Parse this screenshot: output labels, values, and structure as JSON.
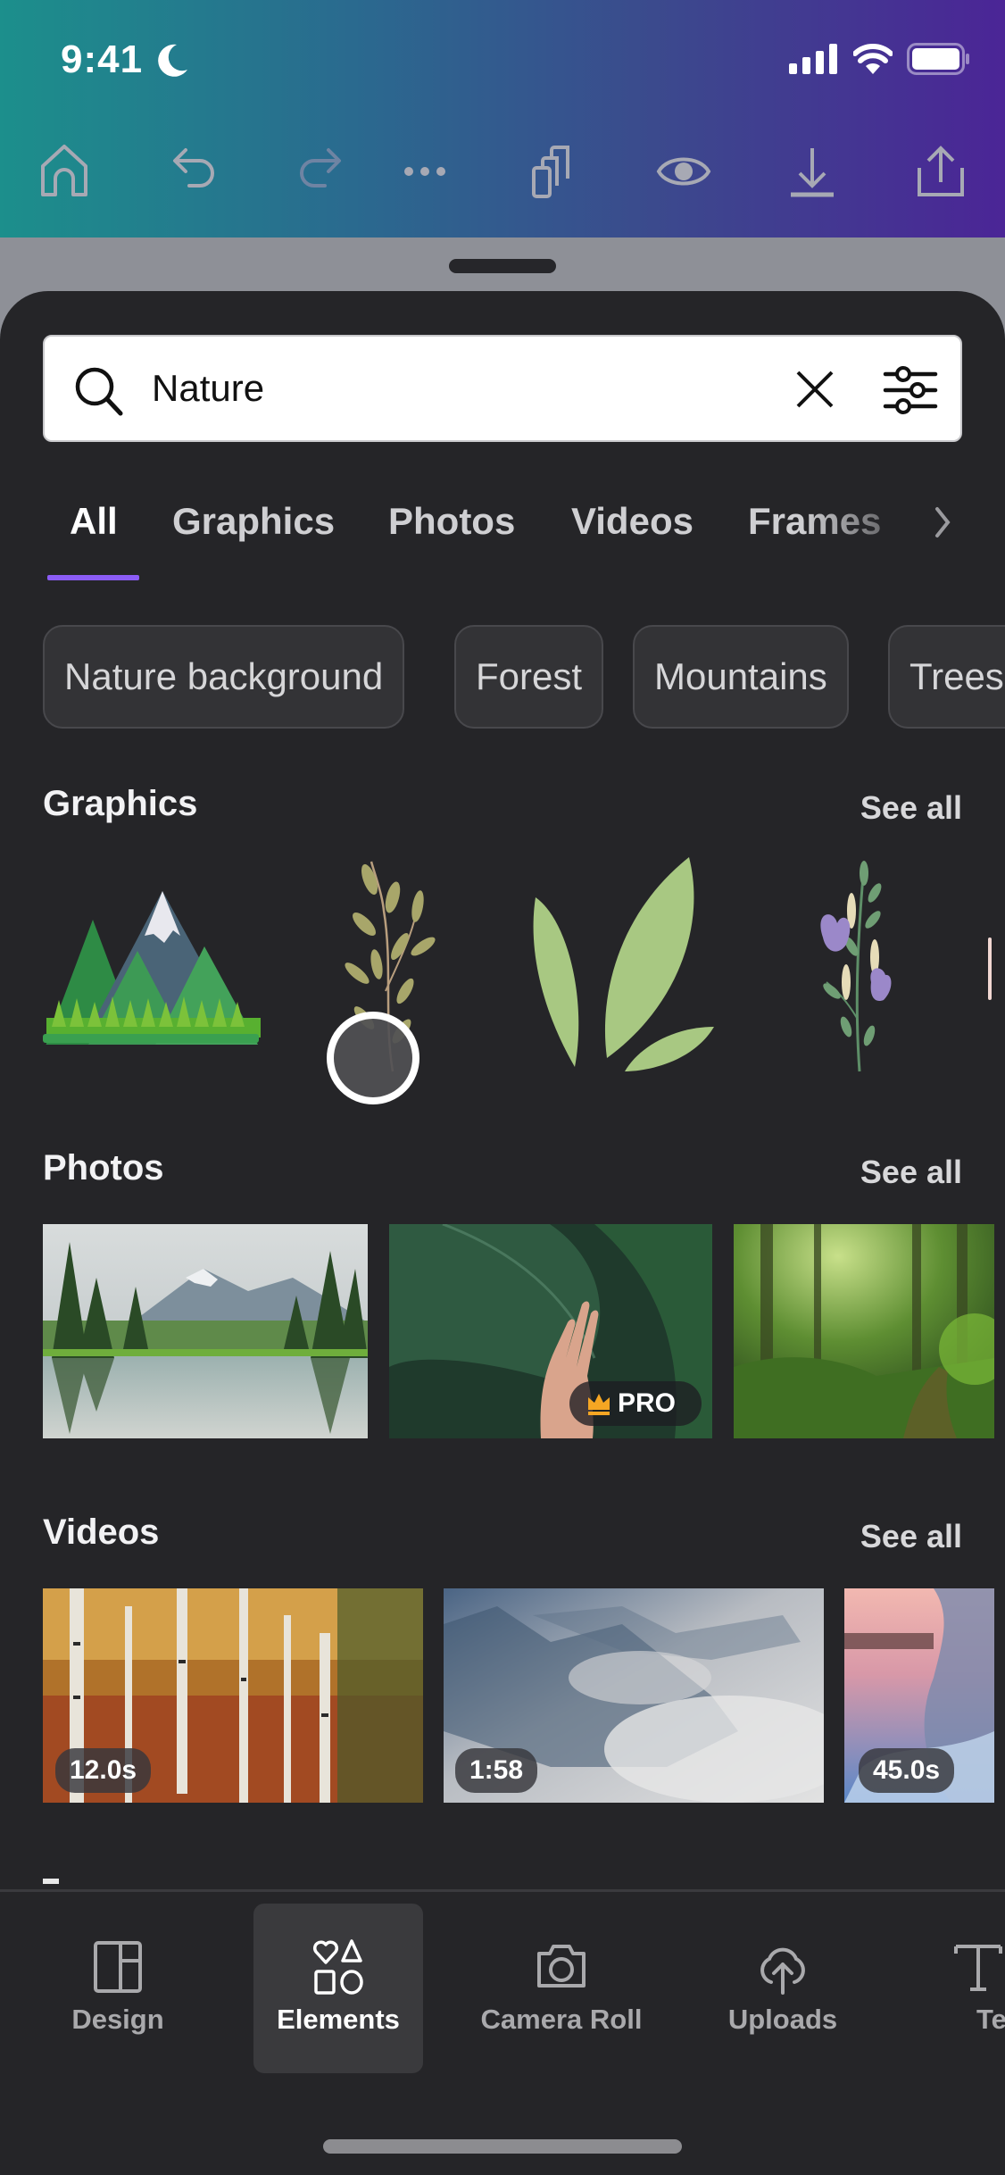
{
  "status_bar": {
    "time": "9:41",
    "focus_icon": "moon-icon",
    "icons": [
      "signal-icon",
      "wifi-icon",
      "battery-icon"
    ]
  },
  "toolbar": {
    "items": [
      {
        "name": "home",
        "icon": "home-icon",
        "enabled": true
      },
      {
        "name": "undo",
        "icon": "undo-icon",
        "enabled": true
      },
      {
        "name": "redo",
        "icon": "redo-icon",
        "enabled": false
      },
      {
        "name": "more",
        "icon": "more-icon",
        "enabled": true
      },
      {
        "name": "pages",
        "icon": "pages-icon",
        "enabled": true
      },
      {
        "name": "preview",
        "icon": "eye-icon",
        "enabled": true
      },
      {
        "name": "download",
        "icon": "download-icon",
        "enabled": true
      },
      {
        "name": "share",
        "icon": "share-icon",
        "enabled": true
      }
    ]
  },
  "search": {
    "value": "Nature",
    "placeholder": "Search",
    "clear_icon": "close-icon",
    "filter_icon": "filter-sliders-icon"
  },
  "tabs": [
    {
      "label": "All",
      "active": true
    },
    {
      "label": "Graphics",
      "active": false
    },
    {
      "label": "Photos",
      "active": false
    },
    {
      "label": "Videos",
      "active": false
    },
    {
      "label": "Frames",
      "active": false
    }
  ],
  "chips": [
    "Nature background",
    "Forest",
    "Mountains",
    "Trees"
  ],
  "sections": {
    "graphics": {
      "title": "Graphics",
      "see_all": "See all",
      "items": [
        "mountain-illustration",
        "olive-branch-illustration",
        "green-leaves-illustration",
        "lavender-flower-illustration"
      ]
    },
    "photos": {
      "title": "Photos",
      "see_all": "See all",
      "items": [
        {
          "subject": "mountain lake with pine trees",
          "badge": ""
        },
        {
          "subject": "hand touching green leaf",
          "badge": "PRO"
        },
        {
          "subject": "sunlit forest path",
          "badge": ""
        }
      ]
    },
    "videos": {
      "title": "Videos",
      "see_all": "See all",
      "items": [
        {
          "subject": "autumn birch forest",
          "duration": "12.0s"
        },
        {
          "subject": "misty pine forest",
          "duration": "1:58"
        },
        {
          "subject": "ocean waves on rocks at sunset",
          "duration": "45.0s"
        }
      ]
    }
  },
  "bottom_nav": [
    {
      "label": "Design",
      "icon": "design-layout-icon",
      "active": false
    },
    {
      "label": "Elements",
      "icon": "elements-shapes-icon",
      "active": true
    },
    {
      "label": "Camera Roll",
      "icon": "camera-icon",
      "active": false
    },
    {
      "label": "Uploads",
      "icon": "cloud-upload-icon",
      "active": false
    },
    {
      "label": "Text",
      "icon": "text-icon",
      "active": false
    }
  ],
  "colors": {
    "accent": "#8b5cf6",
    "sheet_bg": "#252528",
    "pro_crown": "#f5a623"
  }
}
